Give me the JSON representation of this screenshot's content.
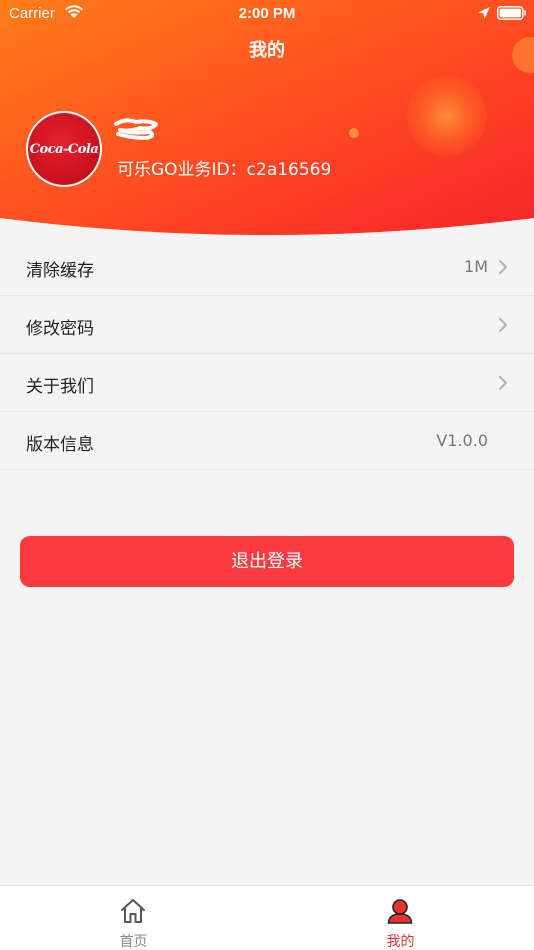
{
  "status_bar": {
    "carrier": "Carrier",
    "time": "2:00 PM"
  },
  "header": {
    "title": "我的",
    "avatar_logo_text": "Coca-Cola",
    "user_id_line": "可乐GO业务ID：c2a16569"
  },
  "settings": {
    "items": [
      {
        "label": "清除缓存",
        "value": "1M",
        "chevron": true
      },
      {
        "label": "修改密码",
        "value": "",
        "chevron": true
      },
      {
        "label": "关于我们",
        "value": "",
        "chevron": true
      },
      {
        "label": "版本信息",
        "value": "V1.0.0",
        "chevron": false
      }
    ]
  },
  "logout_label": "退出登录",
  "tab_bar": {
    "tabs": [
      {
        "label": "首页",
        "icon": "home-icon",
        "active": false
      },
      {
        "label": "我的",
        "icon": "user-icon",
        "active": true
      }
    ]
  },
  "colors": {
    "accent": "#fb3a3f",
    "header_gradient_start": "#ff7a1a",
    "header_gradient_end": "#f52a2a"
  }
}
